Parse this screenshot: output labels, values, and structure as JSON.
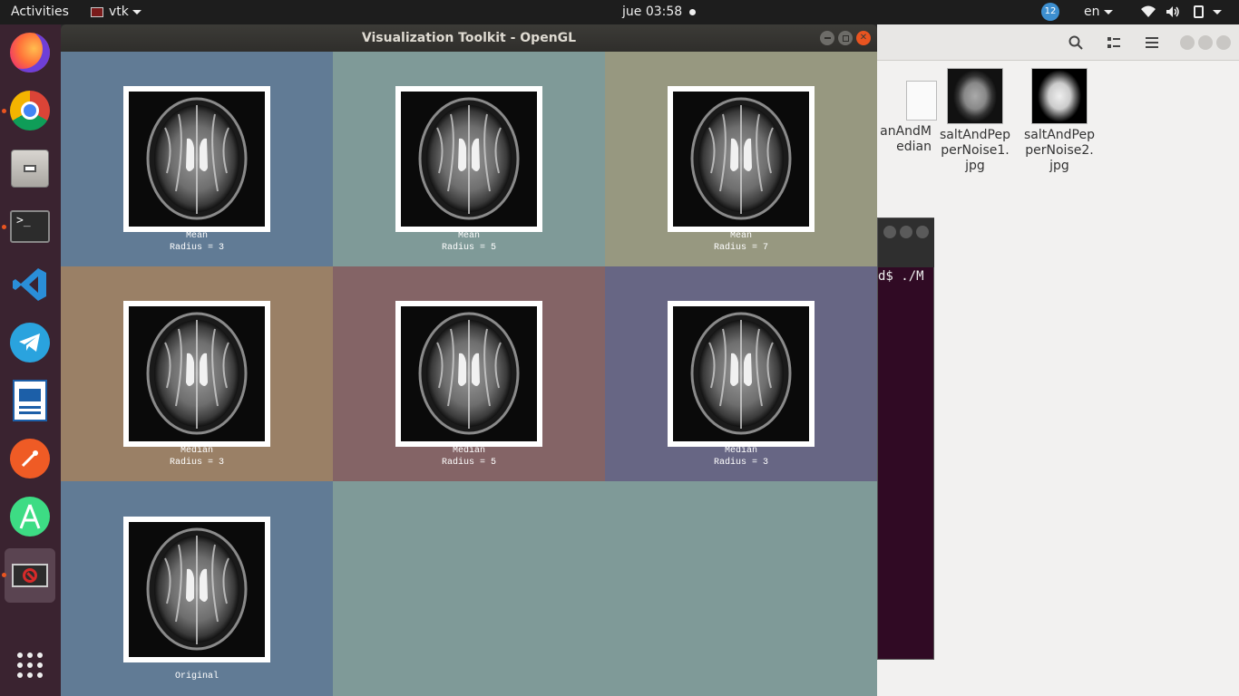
{
  "topbar": {
    "activities": "Activities",
    "app_menu": "vtk",
    "clock": "jue 03:58",
    "notification_count": "12",
    "language": "en"
  },
  "dock": {
    "apps": [
      {
        "name": "firefox-icon"
      },
      {
        "name": "chrome-icon"
      },
      {
        "name": "files-icon"
      },
      {
        "name": "terminal-icon"
      },
      {
        "name": "vscode-icon"
      },
      {
        "name": "telegram-icon"
      },
      {
        "name": "libreoffice-impress-icon"
      },
      {
        "name": "postman-icon"
      },
      {
        "name": "android-studio-icon"
      },
      {
        "name": "vtk-app-icon"
      }
    ],
    "grid_icon": "show-applications-icon"
  },
  "file_manager": {
    "files": [
      {
        "label_line1": "anAndM",
        "label_line2": "edian",
        "label_line3": ""
      },
      {
        "label_line1": "saltAndPep",
        "label_line2": "perNoise1.",
        "label_line3": "jpg"
      },
      {
        "label_line1": "saltAndPep",
        "label_line2": "perNoise2.",
        "label_line3": "jpg"
      }
    ]
  },
  "terminal": {
    "prompt_fragment": "d$ ./M"
  },
  "vtk_window": {
    "title": "Visualization Toolkit - OpenGL",
    "viewports": [
      {
        "line1": "Mean",
        "line2": "Radius = 3",
        "bg": "#617b95"
      },
      {
        "line1": "Mean",
        "line2": "Radius = 5",
        "bg": "#7f9a98"
      },
      {
        "line1": "Mean",
        "line2": "Radius = 7",
        "bg": "#979880"
      },
      {
        "line1": "Median",
        "line2": "Radius = 3",
        "bg": "#9a8066"
      },
      {
        "line1": "Median",
        "line2": "Radius = 5",
        "bg": "#846466"
      },
      {
        "line1": "Median",
        "line2": "Radius = 3",
        "bg": "#676684"
      },
      {
        "line1": "Original",
        "line2": "",
        "bg": "#617b95"
      }
    ],
    "empty_bg": "#7f9a98"
  },
  "colors": {
    "accent": "#e95420",
    "close_button": "#e95420",
    "dock_bg": "#3a2330",
    "terminal_bg": "#300a24"
  }
}
